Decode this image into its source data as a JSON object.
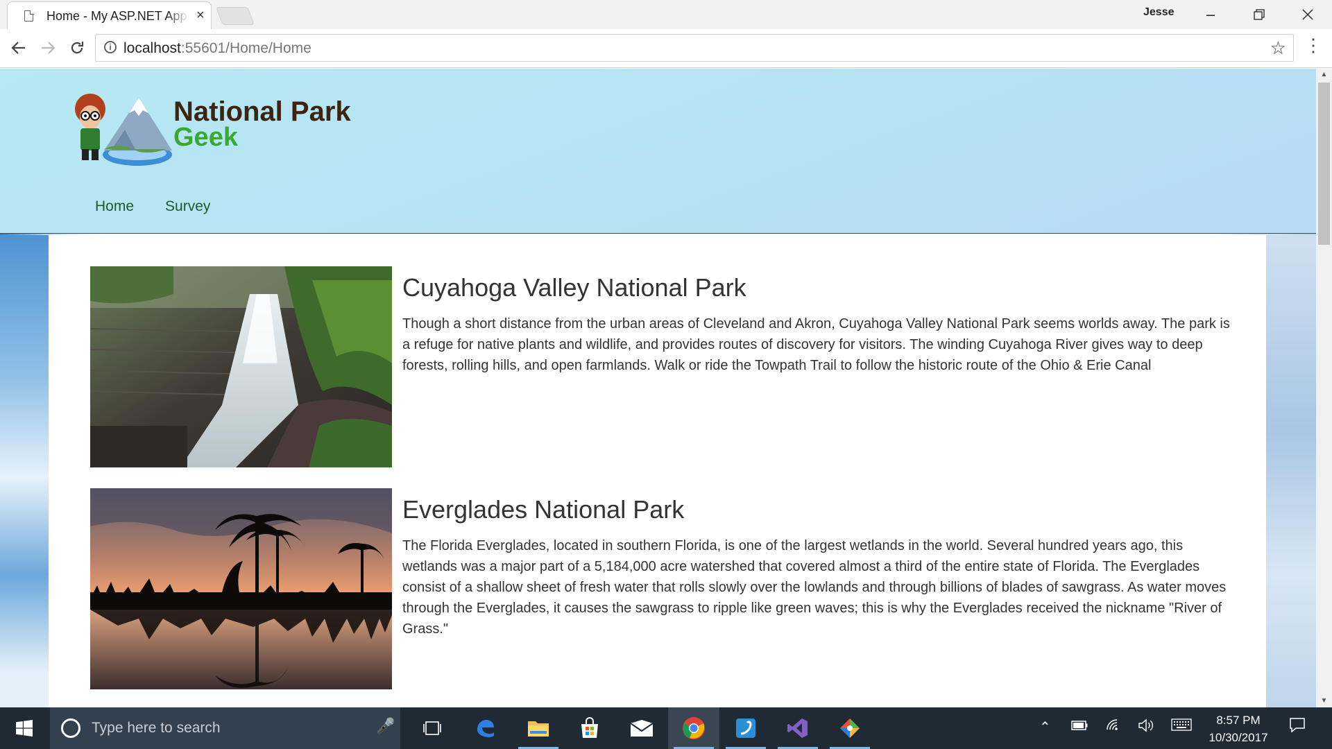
{
  "browser": {
    "tab_title": "Home - My ASP.NET App",
    "tab_close": "×",
    "profile_name": "Jesse",
    "url_host": "localhost",
    "url_rest": ":55601/Home/Home",
    "icons": {
      "back": "arrow-left-icon",
      "forward": "arrow-right-icon",
      "reload": "reload-icon",
      "bookmark": "star-icon",
      "menu": "menu-dots-icon"
    }
  },
  "site": {
    "logo_line1": "National Park",
    "logo_line2": "Geek",
    "nav": [
      {
        "label": "Home"
      },
      {
        "label": "Survey"
      }
    ],
    "parks": [
      {
        "name": "Cuyahoga Valley National Park",
        "description": "Though a short distance from the urban areas of Cleveland and Akron, Cuyahoga Valley National Park seems worlds away. The park is a refuge for native plants and wildlife, and provides routes of discovery for visitors. The winding Cuyahoga River gives way to deep forests, rolling hills, and open farmlands. Walk or ride the Towpath Trail to follow the historic route of the Ohio & Erie Canal"
      },
      {
        "name": "Everglades National Park",
        "description": "The Florida Everglades, located in southern Florida, is one of the largest wetlands in the world. Several hundred years ago, this wetlands was a major part of a 5,184,000 acre watershed that covered almost a third of the entire state of Florida. The Everglades consist of a shallow sheet of fresh water that rolls slowly over the lowlands and through billions of blades of sawgrass. As water moves through the Everglades, it causes the sawgrass to ripple like green waves; this is why the Everglades received the nickname \"River of Grass.\""
      }
    ]
  },
  "taskbar": {
    "search_placeholder": "Type here to search",
    "time": "8:57 PM",
    "date": "10/30/2017",
    "active_app": "chrome"
  },
  "colors": {
    "header_bg": "#b6e4f4",
    "nav_link": "#1e5a2c",
    "logo_brown": "#3d2411",
    "logo_green": "#3aa832",
    "taskbar_bg": "#1f2a35"
  }
}
